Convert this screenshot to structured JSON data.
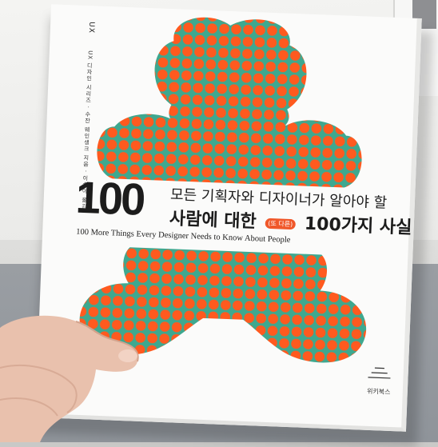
{
  "book": {
    "spine_series": "UX",
    "spine_meta": "UX 디자인 시리즈 · 수잔 웨인생크 지음 · 이승아 옮김",
    "title_number": "100",
    "title_line1": "모든 기획자와 디자이너가 알아야 할",
    "title_line2_a": "사람에 대한",
    "title_badge": "(또 다른)",
    "title_line2_b": "100가지 사실",
    "english_title": "100 More Things Every Designer Needs to Know About People",
    "publisher": "위키북스"
  },
  "colors": {
    "teal": "#3ea88f",
    "orange": "#ff5a1f",
    "paper": "#fbfbfa"
  }
}
